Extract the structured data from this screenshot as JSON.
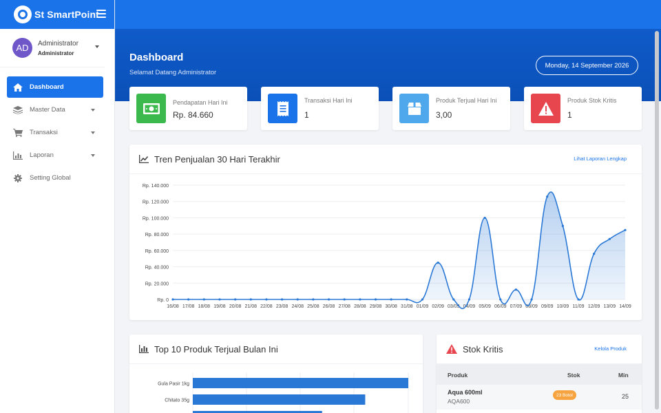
{
  "app": {
    "brand": "St SmartPoint"
  },
  "user": {
    "initials": "AD",
    "name": "Administrator",
    "role": "Administrator"
  },
  "nav": [
    {
      "label": "Dashboard",
      "icon": "home-icon",
      "active": true
    },
    {
      "label": "Master Data",
      "icon": "database-icon"
    },
    {
      "label": "Transaksi",
      "icon": "cart-icon"
    },
    {
      "label": "Laporan",
      "icon": "bar-chart-icon"
    },
    {
      "label": "Setting Global",
      "icon": "gear-icon"
    }
  ],
  "header": {
    "title": "Dashboard",
    "subtitle": "Selamat Datang Administrator",
    "date": "Monday, 14 September 2026"
  },
  "stats": [
    {
      "label": "Pendapatan Hari Ini",
      "value": "Rp. 84.660",
      "icon": "money-icon",
      "color": "#3cb94c"
    },
    {
      "label": "Transaksi Hari Ini",
      "value": "1",
      "icon": "receipt-icon",
      "color": "#1a73e8"
    },
    {
      "label": "Produk Terjual Hari Ini",
      "value": "3,00",
      "icon": "box-icon",
      "color": "#4fa8ec"
    },
    {
      "label": "Produk Stok Kritis",
      "value": "1",
      "icon": "warning-icon",
      "color": "#e8464f"
    }
  ],
  "trend": {
    "title": "Tren Penjualan 30 Hari Terakhir",
    "link": "Lihat Laporan Lengkap"
  },
  "top_products": {
    "title": "Top 10 Produk Terjual Bulan Ini"
  },
  "stok": {
    "title": "Stok Kritis",
    "link": "Kelola Produk",
    "columns": [
      "Produk",
      "Stok",
      "Min"
    ],
    "rows": [
      {
        "name": "Aqua 600ml",
        "code": "AQA600",
        "stock": "23 Botol",
        "min": "25"
      }
    ]
  },
  "chart_data": [
    {
      "type": "area",
      "title": "Tren Penjualan 30 Hari Terakhir",
      "x": [
        "16/08",
        "17/08",
        "18/08",
        "19/08",
        "20/08",
        "21/08",
        "22/08",
        "23/08",
        "24/08",
        "25/08",
        "26/08",
        "27/08",
        "28/08",
        "29/08",
        "30/08",
        "31/08",
        "01/09",
        "02/09",
        "03/09",
        "04/09",
        "05/09",
        "06/09",
        "07/09",
        "08/09",
        "09/09",
        "10/09",
        "11/09",
        "12/09",
        "13/09",
        "14/09"
      ],
      "values": [
        0,
        0,
        0,
        0,
        0,
        0,
        0,
        0,
        0,
        0,
        0,
        0,
        0,
        0,
        0,
        0,
        0,
        45000,
        0,
        0,
        100000,
        0,
        12000,
        0,
        126000,
        90000,
        0,
        56000,
        74000,
        85000
      ],
      "yticks": [
        "Rp. 0",
        "Rp. 20.000",
        "Rp. 40.000",
        "Rp. 60.000",
        "Rp. 80.000",
        "Rp. 100.000",
        "Rp. 120.000",
        "Rp. 140.000"
      ],
      "ylim": [
        0,
        140000
      ],
      "color": "#2a78d6",
      "grid": true
    },
    {
      "type": "bar",
      "orientation": "horizontal",
      "title": "Top 10 Produk Terjual Bulan Ini",
      "categories": [
        "Gula Pasir 1kg",
        "Chitato 35g",
        "Aqua 600ml"
      ],
      "values": [
        100,
        80,
        60
      ],
      "color": "#2a78d6"
    }
  ]
}
